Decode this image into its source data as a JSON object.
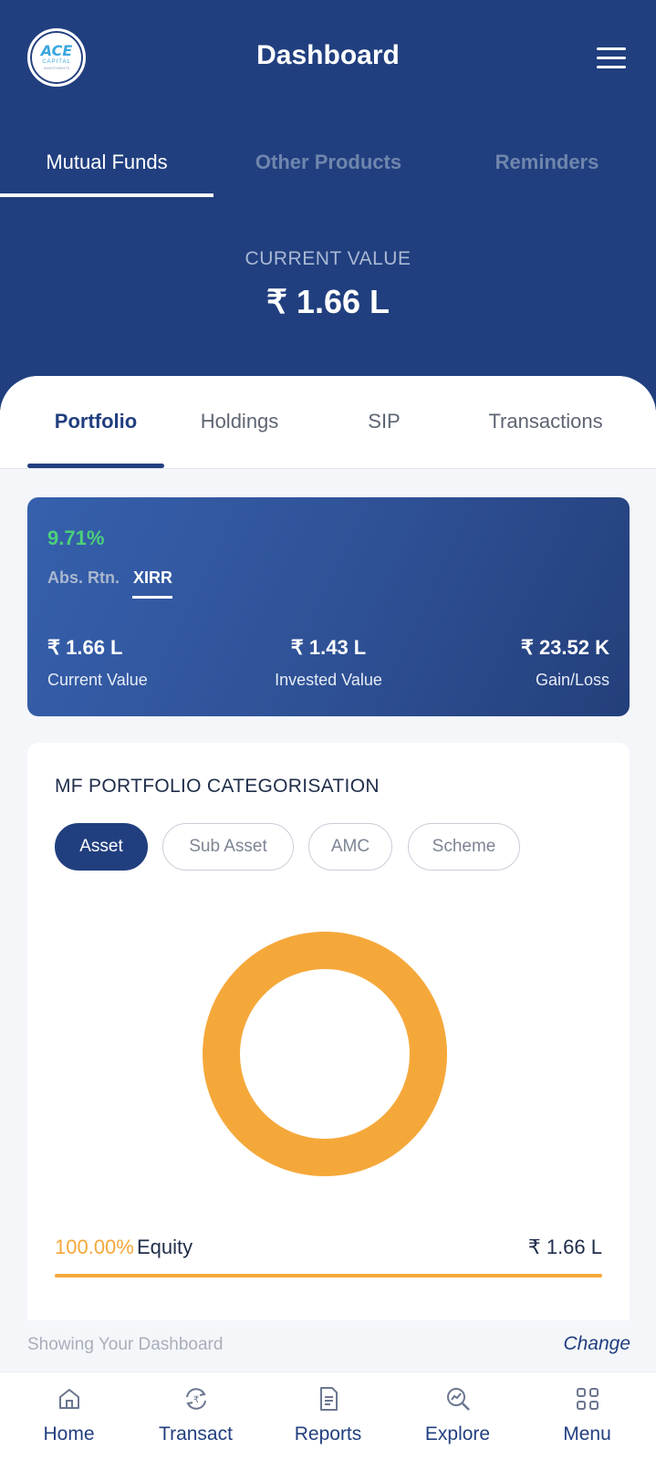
{
  "header": {
    "title": "Dashboard",
    "logo": {
      "line1": "ACE",
      "line2": "CAPITAL",
      "line3": "INVESTMENTS"
    },
    "menu_icon": "hamburger-icon"
  },
  "top_tabs": [
    {
      "label": "Mutual Funds",
      "active": true
    },
    {
      "label": "Other Products",
      "active": false
    },
    {
      "label": "Reminders",
      "active": false
    }
  ],
  "current_value": {
    "label": "CURRENT VALUE",
    "value": "₹ 1.66 L"
  },
  "sub_tabs": [
    {
      "label": "Portfolio",
      "active": true
    },
    {
      "label": "Holdings",
      "active": false
    },
    {
      "label": "SIP",
      "active": false
    },
    {
      "label": "Transactions",
      "active": false
    }
  ],
  "summary": {
    "return_value": "9.71%",
    "toggle": {
      "abs": "Abs. Rtn.",
      "xirr": "XIRR",
      "selected": "XIRR"
    },
    "stats": [
      {
        "value": "₹ 1.66 L",
        "label": "Current Value"
      },
      {
        "value": "₹ 1.43 L",
        "label": "Invested Value"
      },
      {
        "value": "₹ 23.52 K",
        "label": "Gain/Loss"
      }
    ]
  },
  "categorisation": {
    "title": "MF PORTFOLIO CATEGORISATION",
    "chips": [
      {
        "label": "Asset",
        "active": true
      },
      {
        "label": "Sub Asset",
        "active": false
      },
      {
        "label": "AMC",
        "active": false
      },
      {
        "label": "Scheme",
        "active": false
      }
    ],
    "legend": [
      {
        "percent": "100.00%",
        "name": "Equity",
        "amount": "₹ 1.66 L",
        "color": "#f5a83a"
      }
    ]
  },
  "chart_data": {
    "type": "pie",
    "categories": [
      "Equity"
    ],
    "values": [
      100.0
    ],
    "colors": [
      "#f5a83a"
    ]
  },
  "dashboard_strip": {
    "text": "Showing Your Dashboard",
    "change": "Change"
  },
  "bottom_nav": [
    {
      "label": "Home",
      "icon": "home-icon"
    },
    {
      "label": "Transact",
      "icon": "transact-icon"
    },
    {
      "label": "Reports",
      "icon": "reports-icon"
    },
    {
      "label": "Explore",
      "icon": "explore-icon"
    },
    {
      "label": "Menu",
      "icon": "grid-menu-icon"
    }
  ],
  "colors": {
    "primary": "#213f7f",
    "accent_orange": "#f5a83a",
    "positive_green": "#4cd07a"
  }
}
